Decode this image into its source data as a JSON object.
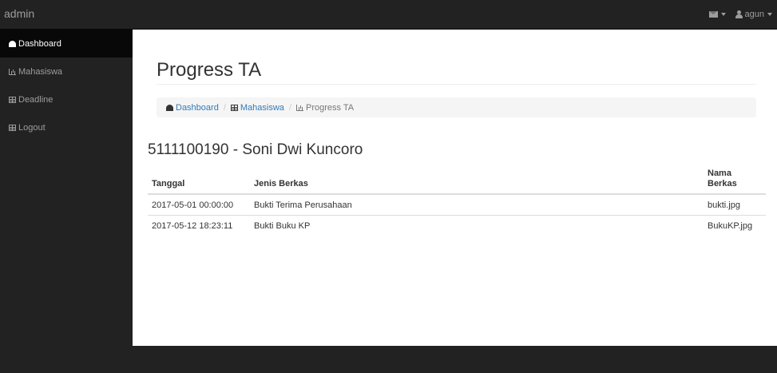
{
  "navbar": {
    "brand": "admin",
    "user_name": "agun"
  },
  "sidebar": {
    "items": [
      {
        "label": "Dashboard",
        "icon": "dashboard-icon",
        "active": true
      },
      {
        "label": "Mahasiswa",
        "icon": "bar-chart-icon"
      },
      {
        "label": "Deadline",
        "icon": "table-icon"
      },
      {
        "label": "Logout",
        "icon": "table-icon"
      }
    ]
  },
  "page": {
    "title": "Progress TA",
    "breadcrumb": [
      {
        "label": "Dashboard",
        "icon": "dashboard-icon"
      },
      {
        "label": "Mahasiswa",
        "icon": "table-icon"
      },
      {
        "label": "Progress TA",
        "icon": "bar-chart-icon"
      }
    ],
    "student_heading": "5111100190 - Soni Dwi Kuncoro"
  },
  "table": {
    "headers": [
      "Tanggal",
      "Jenis Berkas",
      "Nama Berkas"
    ],
    "rows": [
      [
        "2017-05-01 00:00:00",
        "Bukti Terima Perusahaan",
        "bukti.jpg"
      ],
      [
        "2017-05-12 18:23:11",
        "Bukti Buku KP",
        "BukuKP.jpg"
      ]
    ]
  },
  "colors": {
    "navbar_bg": "#222222",
    "sidebar_active_bg": "#080808",
    "link": "#337ab7",
    "breadcrumb_bg": "#f5f5f5"
  }
}
